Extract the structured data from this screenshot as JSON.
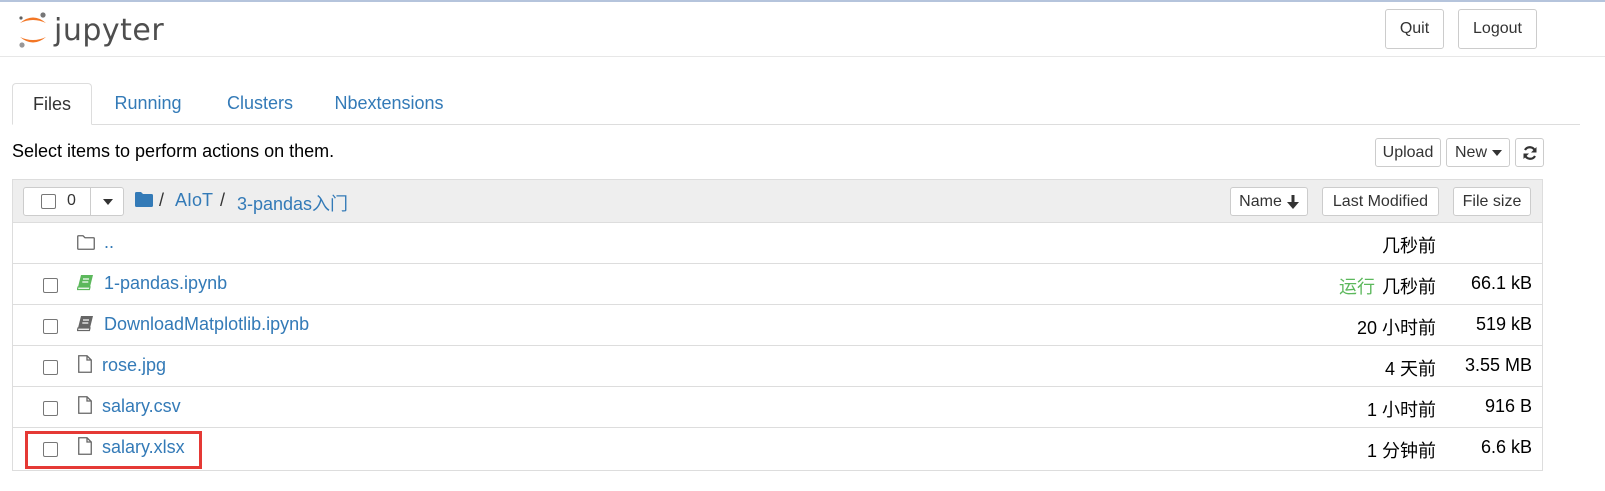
{
  "header": {
    "logo_text": "jupyter",
    "quit_label": "Quit",
    "logout_label": "Logout"
  },
  "tabs": [
    {
      "label": "Files"
    },
    {
      "label": "Running"
    },
    {
      "label": "Clusters"
    },
    {
      "label": "Nbextensions"
    }
  ],
  "toolbar": {
    "hint": "Select items to perform actions on them.",
    "upload_label": "Upload",
    "new_label": "New"
  },
  "list_header": {
    "selected_count": "0",
    "breadcrumb": [
      "/",
      "AIoT",
      "/",
      "3-pandas入门"
    ],
    "sort_name_label": "Name",
    "sort_modified_label": "Last Modified",
    "sort_size_label": "File size"
  },
  "rows": [
    {
      "name": "..",
      "modified": "几秒前",
      "size": "",
      "type": "folder",
      "status": ""
    },
    {
      "name": "1-pandas.ipynb",
      "modified": "几秒前",
      "size": "66.1 kB",
      "type": "notebook-running",
      "status": "运行"
    },
    {
      "name": "DownloadMatplotlib.ipynb",
      "modified": "20 小时前",
      "size": "519 kB",
      "type": "notebook",
      "status": ""
    },
    {
      "name": "rose.jpg",
      "modified": "4 天前",
      "size": "3.55 MB",
      "type": "file",
      "status": ""
    },
    {
      "name": "salary.csv",
      "modified": "1 小时前",
      "size": "916 B",
      "type": "file",
      "status": ""
    },
    {
      "name": "salary.xlsx",
      "modified": "1 分钟前",
      "size": "6.6 kB",
      "type": "file",
      "status": ""
    }
  ],
  "colors": {
    "link": "#337ab7",
    "running": "#5cb85c",
    "logo_orange": "#f37726",
    "highlight": "#e53935"
  }
}
